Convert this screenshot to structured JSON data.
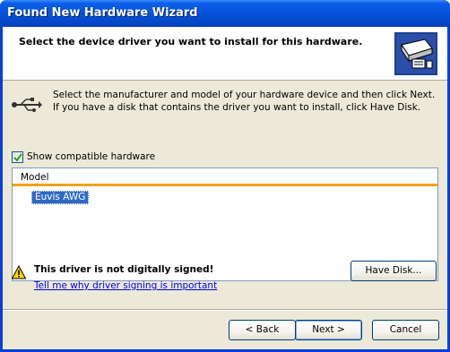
{
  "window": {
    "title": "Found New Hardware Wizard"
  },
  "header": {
    "title": "Select the device driver you want to install for this hardware.",
    "icon": "hardware-card-icon"
  },
  "intro": {
    "icon": "usb-icon",
    "text": "Select the manufacturer and model of your hardware device and then click Next. If you have a disk that contains the driver you want to install, click Have Disk."
  },
  "compatible": {
    "label": "Show compatible hardware",
    "checked": true
  },
  "list": {
    "column_header": "Model",
    "items": [
      "Euvis AWG"
    ],
    "selected_index": 0,
    "header_accent_color": "#f3a11a",
    "selection_color": "#316ac5"
  },
  "warning": {
    "icon": "warning-icon",
    "text": "This driver is not digitally signed!",
    "link": "Tell me why driver signing is important"
  },
  "buttons": {
    "have_disk": "Have Disk...",
    "back": "< Back",
    "next": "Next >",
    "cancel": "Cancel"
  },
  "colors": {
    "titlebar": "#0653d8",
    "dialog_bg": "#ece9d8"
  }
}
